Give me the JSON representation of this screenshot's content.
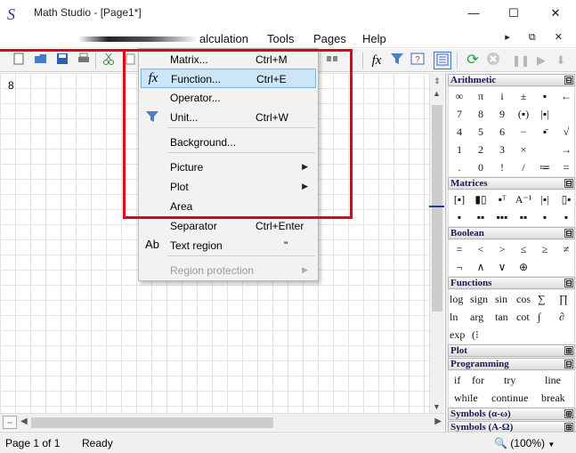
{
  "window": {
    "title": "Math Studio - [Page1*]",
    "app_icon_glyph": "S",
    "minimize_glyph": "—",
    "maximize_glyph": "☐",
    "close_glyph": "✕"
  },
  "menubar": {
    "items": [
      "alculation",
      "Tools",
      "Pages",
      "Help"
    ],
    "mdi_controls": "▸ ⧉ ✕"
  },
  "toolbar": {
    "left_icons": [
      "new-page-icon",
      "open-folder-icon",
      "save-icon",
      "print-icon",
      "cut-icon",
      "copy-icon"
    ],
    "right_icons": [
      "insert-icon",
      "function-icon",
      "unit-filter-icon",
      "help-icon",
      "panel-toggle-icon",
      "refresh-icon",
      "stop-icon",
      "pause-icon",
      "play-icon",
      "download-icon"
    ]
  },
  "worksheet": {
    "value": "8"
  },
  "context_menu": {
    "items": [
      {
        "label": "Matrix...",
        "shortcut": "Ctrl+M",
        "icon": "",
        "highlighted": false,
        "disabled": false,
        "submenu": false
      },
      {
        "label": "Function...",
        "shortcut": "Ctrl+E",
        "icon": "fx",
        "highlighted": true,
        "disabled": false,
        "submenu": false
      },
      {
        "label": "Operator...",
        "shortcut": "",
        "icon": "",
        "highlighted": false,
        "disabled": false,
        "submenu": false
      },
      {
        "label": "Unit...",
        "shortcut": "Ctrl+W",
        "icon": "funnel",
        "highlighted": false,
        "disabled": false,
        "submenu": false
      },
      {
        "label": "Background...",
        "shortcut": "",
        "icon": "",
        "highlighted": false,
        "disabled": false,
        "submenu": false
      },
      {
        "label": "Picture",
        "shortcut": "",
        "icon": "",
        "highlighted": false,
        "disabled": false,
        "submenu": true
      },
      {
        "label": "Plot",
        "shortcut": "",
        "icon": "",
        "highlighted": false,
        "disabled": false,
        "submenu": true
      },
      {
        "label": "Area",
        "shortcut": "",
        "icon": "",
        "highlighted": false,
        "disabled": false,
        "submenu": false
      },
      {
        "label": "Separator",
        "shortcut": "Ctrl+Enter",
        "icon": "",
        "highlighted": false,
        "disabled": false,
        "submenu": false
      },
      {
        "label": "Text region",
        "shortcut": "\"",
        "icon": "Ab",
        "highlighted": false,
        "disabled": false,
        "submenu": false
      },
      {
        "label": "Region protection",
        "shortcut": "",
        "icon": "",
        "highlighted": false,
        "disabled": true,
        "submenu": true
      }
    ]
  },
  "panel": {
    "arithmetic": {
      "title": "Arithmetic",
      "toggle": "⊟",
      "rows": [
        [
          "∞",
          "π",
          "i",
          "±",
          "▪",
          "←"
        ],
        [
          "7",
          "8",
          "9",
          "(▪)",
          "|▪|",
          ""
        ],
        [
          "4",
          "5",
          "6",
          "−",
          "▪̄",
          "√"
        ],
        [
          "1",
          "2",
          "3",
          "×",
          "",
          "→"
        ],
        [
          ".",
          "0",
          "!",
          "/",
          "≔",
          "="
        ]
      ]
    },
    "matrices": {
      "title": "Matrices",
      "toggle": "⊟",
      "rows": [
        [
          "[▪]",
          "▮▯",
          "▪ᵀ",
          "A⁻¹",
          "|▪|",
          "▯▪"
        ],
        [
          "▪",
          "▪▪",
          "▪▪▪",
          "▪▪",
          "▪",
          "▪"
        ]
      ]
    },
    "boolean": {
      "title": "Boolean",
      "toggle": "⊟",
      "rows": [
        [
          "=",
          "<",
          ">",
          "≤",
          "≥",
          "≠"
        ],
        [
          "¬",
          "∧",
          "∨",
          "⊕"
        ]
      ]
    },
    "functions": {
      "title": "Functions",
      "toggle": "⊟",
      "rows": [
        [
          "log",
          "sign",
          "sin",
          "cos",
          "∑",
          "∏"
        ],
        [
          "ln",
          "arg",
          "tan",
          "cot",
          "∫",
          "∂"
        ],
        [
          "exp",
          "(⁝"
        ]
      ]
    },
    "plot": {
      "title": "Plot",
      "toggle": "⊞"
    },
    "programming": {
      "title": "Programming",
      "toggle": "⊟",
      "rows": [
        [
          "if",
          "for",
          "try",
          "line"
        ],
        [
          "while",
          "continue",
          "break"
        ]
      ]
    },
    "symbols_a": {
      "title": "Symbols (α-ω)",
      "toggle": "⊞"
    },
    "symbols_b": {
      "title": "Symbols (Α-Ω)",
      "toggle": "⊞"
    }
  },
  "statusbar": {
    "page": "Page 1 of 1",
    "status": "Ready",
    "zoom": "(100%)"
  }
}
